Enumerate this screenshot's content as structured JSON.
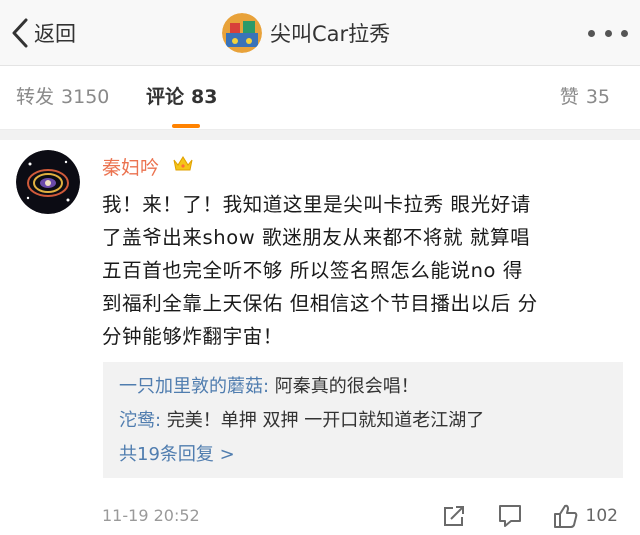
{
  "header": {
    "back_label": "返回",
    "title": "尖叫Car拉秀"
  },
  "tabs": {
    "repost_label": "转发",
    "repost_count": "3150",
    "comment_label": "评论",
    "comment_count": "83",
    "like_label": "赞",
    "like_count": "35"
  },
  "comment": {
    "username": "秦妇吟",
    "lines": [
      "我！来！了！我知道这里是尖叫卡拉秀 眼光好请",
      "了盖爷出来show 歌迷朋友从来都不将就 就算唱",
      "五百首也完全听不够 所以签名照怎么能说no  得",
      "到福利全靠上天保佑 但相信这个节目播出以后 分",
      "分钟能够炸翻宇宙！"
    ],
    "replies": [
      {
        "author": "一只加里敦的蘑菇:",
        "text": " 阿秦真的很会唱！"
      },
      {
        "author": "沱鸯:",
        "text": " 完美！单押 双押 一开口就知道老江湖了"
      }
    ],
    "more_replies": "共19条回复 >",
    "time": "11-19 20:52",
    "like_count": "102"
  },
  "icons": {
    "back": "chevron-left-icon",
    "more": "more-dots-icon",
    "crown": "crown-badge-icon",
    "share": "share-icon",
    "comment": "comment-icon",
    "like": "thumbs-up-icon"
  },
  "colors": {
    "accent": "#ff8200",
    "username": "#eb7350",
    "link": "#507daf"
  }
}
